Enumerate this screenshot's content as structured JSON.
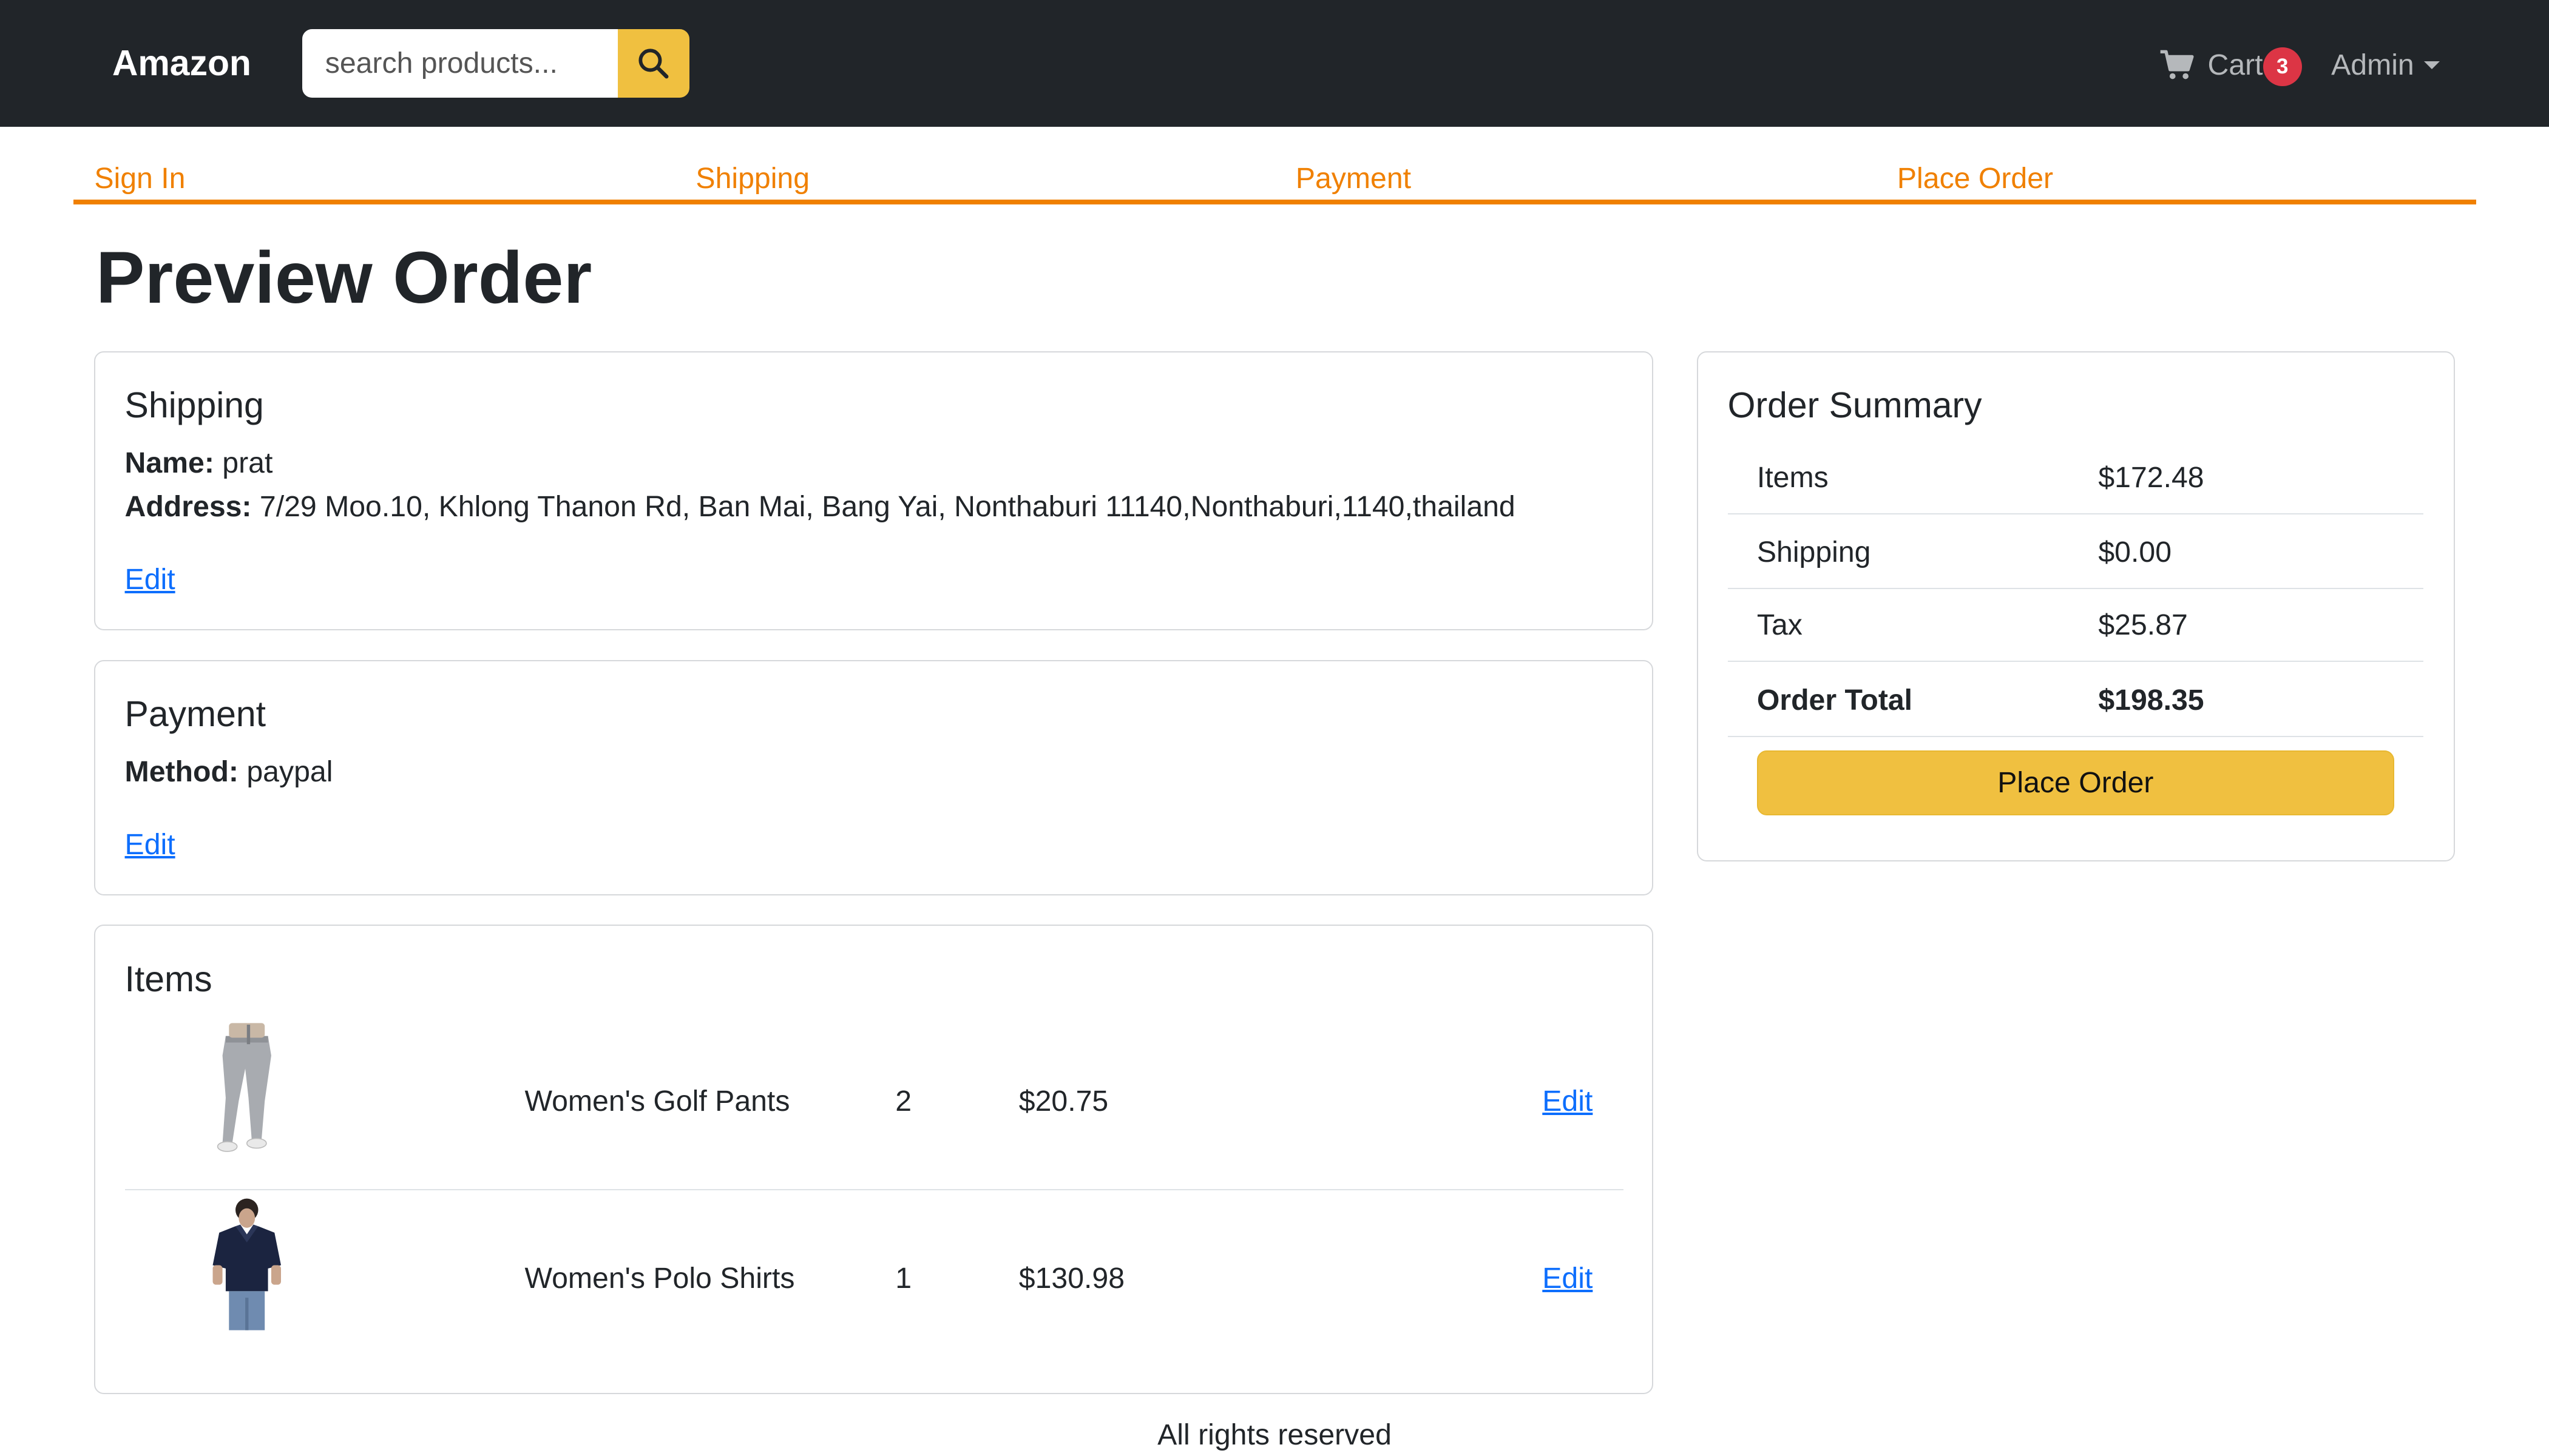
{
  "navbar": {
    "brand": "Amazon",
    "search_placeholder": "search products...",
    "cart_label": "Cart",
    "cart_count": "3",
    "user_menu": "Admin"
  },
  "steps": [
    "Sign In",
    "Shipping",
    "Payment",
    "Place Order"
  ],
  "page_title": "Preview Order",
  "shipping": {
    "title": "Shipping",
    "name_label": "Name:",
    "name": "prat",
    "address_label": "Address:",
    "address": "7/29 Moo.10, Khlong Thanon Rd, Ban Mai, Bang Yai, Nonthaburi 11140,Nonthaburi,1140,thailand",
    "edit": "Edit"
  },
  "payment": {
    "title": "Payment",
    "method_label": "Method:",
    "method": "paypal",
    "edit": "Edit"
  },
  "items": {
    "title": "Items",
    "rows": [
      {
        "name": "Women's Golf Pants",
        "qty": "2",
        "price": "$20.75",
        "edit": "Edit"
      },
      {
        "name": "Women's Polo Shirts",
        "qty": "1",
        "price": "$130.98",
        "edit": "Edit"
      }
    ]
  },
  "summary": {
    "title": "Order Summary",
    "rows": [
      {
        "label": "Items",
        "value": "$172.48"
      },
      {
        "label": "Shipping",
        "value": "$0.00"
      },
      {
        "label": "Tax",
        "value": "$25.87"
      },
      {
        "label": "Order Total",
        "value": "$198.35"
      }
    ],
    "place_order": "Place Order"
  },
  "footer": "All rights reserved",
  "colors": {
    "navbar": "#212529",
    "accent_yellow": "#f0c040",
    "step_orange": "#f08000",
    "link_blue": "#0d6efd",
    "badge_red": "#dc3545"
  },
  "icons": [
    "search-icon",
    "cart-icon",
    "chevron-down-icon"
  ]
}
